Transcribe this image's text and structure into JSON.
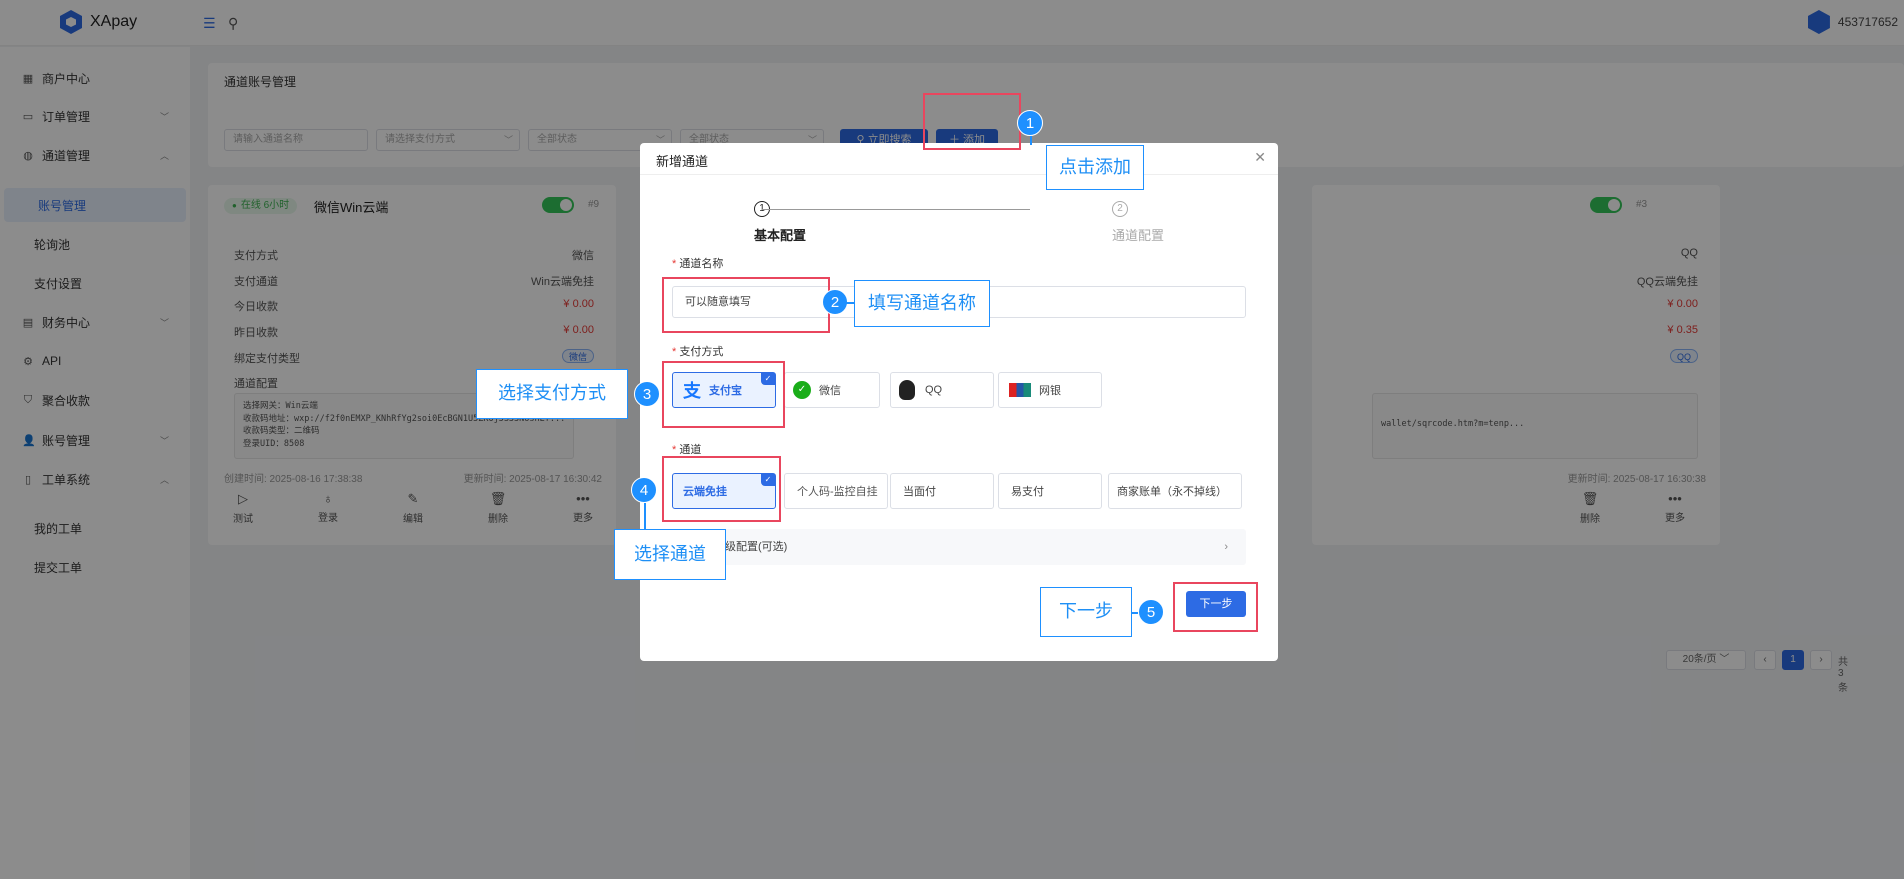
{
  "topbar": {
    "app_name": "XApay",
    "user_id": "453717652"
  },
  "sidebar": {
    "items": [
      {
        "label": "商户中心"
      },
      {
        "label": "订单管理"
      },
      {
        "label": "通道管理"
      },
      {
        "label": "账号管理"
      },
      {
        "label": "轮询池"
      },
      {
        "label": "支付设置"
      },
      {
        "label": "财务中心"
      },
      {
        "label": "API"
      },
      {
        "label": "聚合收款"
      },
      {
        "label": "账号管理"
      },
      {
        "label": "工单系统"
      },
      {
        "label": "我的工单"
      },
      {
        "label": "提交工单"
      }
    ]
  },
  "filter": {
    "title": "通道账号管理",
    "name_placeholder": "请输入通道名称",
    "pay_method_placeholder": "请选择支付方式",
    "status1": "全部状态",
    "status2": "全部状态",
    "search_label": "立即搜索",
    "add_label": "添加"
  },
  "card_left": {
    "status": "在线 6小时",
    "title": "微信Win云端",
    "id": "#9",
    "rows": [
      {
        "key": "支付方式",
        "value": "微信"
      },
      {
        "key": "支付通道",
        "value": "Win云端免挂"
      },
      {
        "key": "今日收款",
        "value": "¥ 0.00"
      },
      {
        "key": "昨日收款",
        "value": "¥ 0.00"
      },
      {
        "key": "绑定支付类型",
        "value": "微信"
      },
      {
        "key": "通道配置",
        "value": ""
      }
    ],
    "config": "选择网关：Win云端\n收款码地址：wxp://f2f0nEMXP_KNhRfYg2soi0EcBGN1U5ZKOj5S33NoshEf...\n收款码类型：二维码\n登录UID：8508",
    "created": "创建时间: 2025-08-16 17:38:38",
    "updated": "更新时间: 2025-08-17 16:30:42",
    "actions": [
      "测试",
      "登录",
      "编辑",
      "删除",
      "更多"
    ]
  },
  "card_right": {
    "id": "#3",
    "pay_method": "QQ",
    "channel": "QQ云端免挂",
    "today": "¥ 0.00",
    "yesterday": "¥ 0.35",
    "bind_type": "QQ",
    "config_url": "wallet/sqrcode.htm?m=tenp...",
    "updated": "更新时间: 2025-08-17 16:30:38",
    "actions": [
      "删除",
      "更多"
    ]
  },
  "pagination": {
    "page_size": "20条/页",
    "current_page": "1",
    "total": "共 3 条"
  },
  "modal": {
    "title": "新增通道",
    "steps": [
      {
        "num": "1",
        "label": "基本配置"
      },
      {
        "num": "2",
        "label": "通道配置"
      }
    ],
    "channel_name_label": "通道名称",
    "channel_name_value": "可以随意填写",
    "pay_method_label": "支付方式",
    "pay_methods": [
      "支付宝",
      "微信",
      "QQ",
      "网银"
    ],
    "channel_label": "通道",
    "channels": [
      "云端免挂",
      "个人码-监控自挂",
      "当面付",
      "易支付",
      "商家账单（永不掉线）"
    ],
    "advanced_label": "高级配置(可选)",
    "next_label": "下一步"
  },
  "annotations": {
    "n1": "1",
    "t1": "点击添加",
    "n2": "2",
    "t2": "填写通道名称",
    "n3": "3",
    "t3": "选择支付方式",
    "n4": "4",
    "t4": "选择通道",
    "n5": "5",
    "t5": "下一步"
  },
  "colors": {
    "accent": "#2d6be4",
    "highlight": "#e9465e",
    "callout": "#1e90ff",
    "success": "#34c759",
    "money": "#e53935"
  }
}
